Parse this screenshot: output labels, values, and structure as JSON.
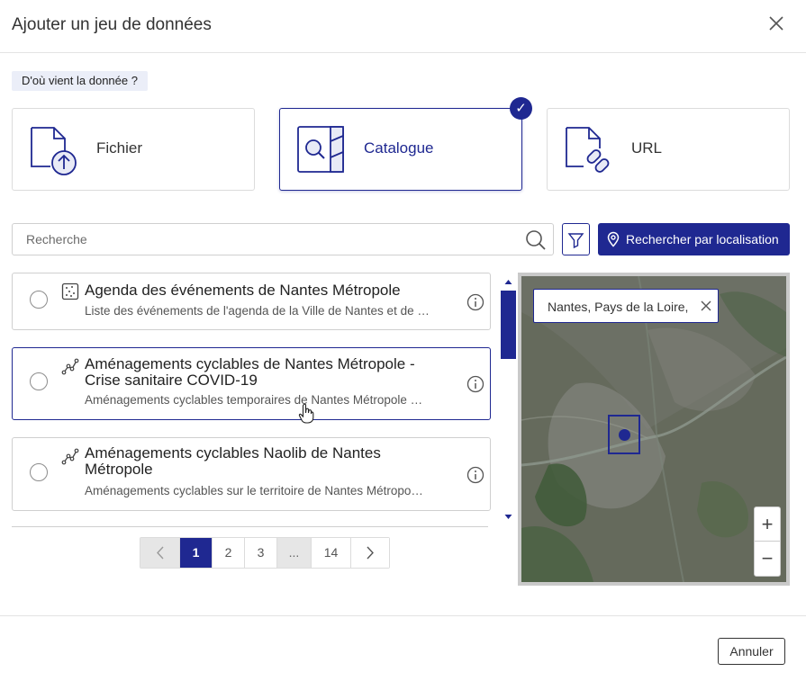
{
  "modal": {
    "title": "Ajouter un jeu de données"
  },
  "source": {
    "question": "D'où vient la donnée ?",
    "options": [
      {
        "label": "Fichier",
        "icon": "file-upload-icon",
        "selected": false
      },
      {
        "label": "Catalogue",
        "icon": "catalog-search-icon",
        "selected": true
      },
      {
        "label": "URL",
        "icon": "file-link-icon",
        "selected": false
      }
    ]
  },
  "search": {
    "placeholder": "Recherche",
    "location_button": "Rechercher par localisation"
  },
  "results": [
    {
      "title": "Agenda des événements de Nantes Métropole",
      "description": "Liste des événements de l'agenda de la Ville de Nantes et de …",
      "type_icon": "point-data-icon"
    },
    {
      "title": "Aménagements cyclables de Nantes Métropole - Crise sanitaire COVID-19",
      "description": "Aménagements cyclables temporaires de Nantes Métropole …",
      "type_icon": "line-data-icon"
    },
    {
      "title": "Aménagements cyclables Naolib de Nantes Métropole",
      "description": "Aménagements cyclables sur le territoire de Nantes Métropo…",
      "type_icon": "line-data-icon"
    }
  ],
  "pagination": {
    "pages": [
      "1",
      "2",
      "3",
      "...",
      "14"
    ],
    "current": "1"
  },
  "map": {
    "location_text": "Nantes, Pays de la Loire,",
    "zoom_in": "+",
    "zoom_out": "−"
  },
  "footer": {
    "cancel_label": "Annuler"
  },
  "colors": {
    "accent": "#1f2891",
    "border": "#cfcfcf",
    "label_bg": "#ebeef8"
  }
}
